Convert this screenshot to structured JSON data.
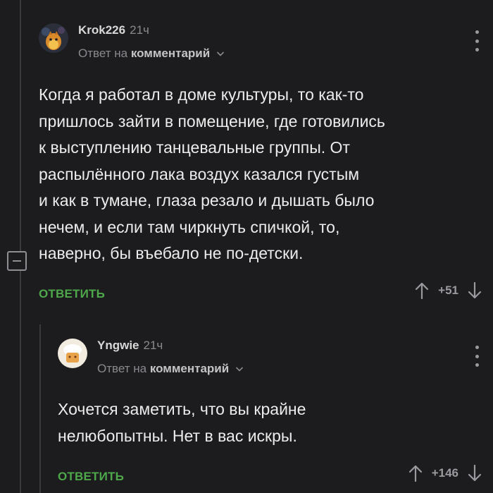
{
  "comments": [
    {
      "username": "Krok226",
      "time": "21ч",
      "reply_prefix": "Ответ на",
      "reply_target": "комментарий",
      "text": "Когда я работал в доме культуры, то как-то\nпришлось зайти в помещение, где готовились\nк выступлению танцевальные группы. От\nраспылённого лака воздух казался густым\nи как в тумане, глаза резало и дышать было\nнечем, и если там чиркнуть спичкой, то,\nнаверно, бы въебало не по-детски.",
      "reply_label": "ОТВЕТИТЬ",
      "score": "+51"
    },
    {
      "username": "Yngwie",
      "time": "21ч",
      "reply_prefix": "Ответ на",
      "reply_target": "комментарий",
      "text": "Хочется заметить, что вы крайне\nнелюбопытны. Нет в вас искры.",
      "reply_label": "ОТВЕТИТЬ",
      "score": "+146"
    }
  ],
  "icons": {
    "more": "more-vertical-icon",
    "upvote": "arrow-up-icon",
    "downvote": "arrow-down-icon",
    "collapse": "minus-icon",
    "chevron": "chevron-down-icon"
  },
  "colors": {
    "background": "#1c1c1e",
    "accent": "#4ea74a",
    "text": "#ececec",
    "muted": "#8a8a8e"
  }
}
